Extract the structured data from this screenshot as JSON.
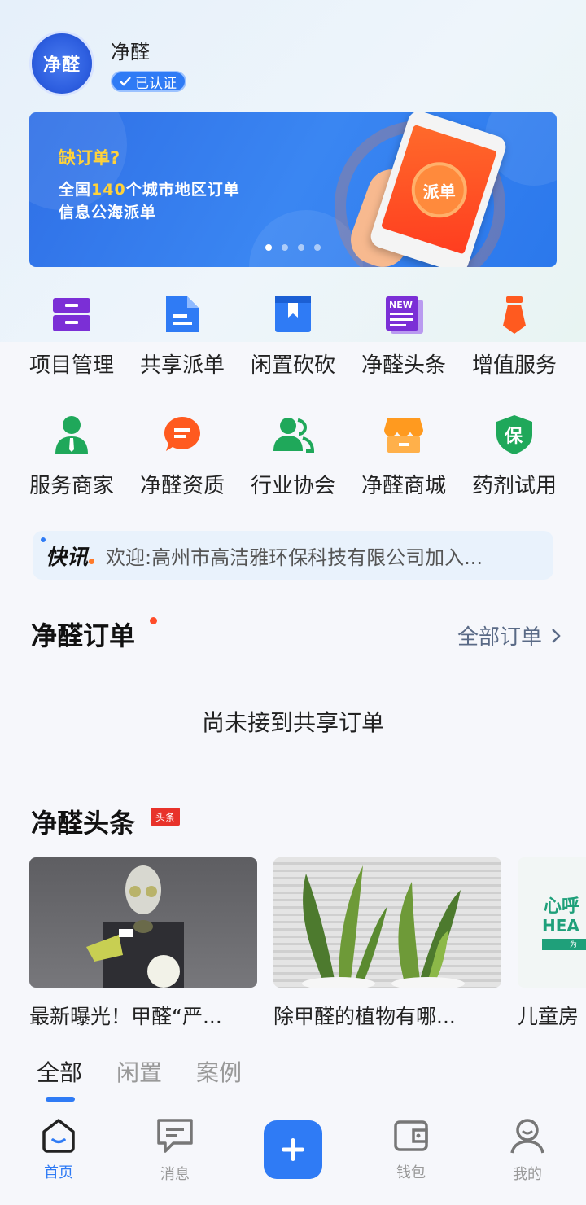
{
  "profile": {
    "logo_text": "净醛",
    "name": "净醛",
    "verified_label": "已认证"
  },
  "banner": {
    "title": "缺订单?",
    "line1_prefix": "全国",
    "line1_highlight": "140",
    "line1_suffix": "个城市地区订单",
    "line2": "信息公海派单",
    "phone_badge": "派单",
    "dots": 4,
    "active_dot": 0
  },
  "grid": {
    "items": [
      {
        "label": "项目管理",
        "icon": "cabinet-icon",
        "color": "#7b2fd6"
      },
      {
        "label": "共享派单",
        "icon": "document-icon",
        "color": "#2f7bf5"
      },
      {
        "label": "闲置砍砍",
        "icon": "box-icon",
        "color": "#2f7bf5"
      },
      {
        "label": "净醛头条",
        "icon": "news-icon",
        "color": "#7b2fd6",
        "badge": "NEW"
      },
      {
        "label": "增值服务",
        "icon": "tie-icon",
        "color": "#ff5a1f"
      },
      {
        "label": "服务商家",
        "icon": "person-icon",
        "color": "#1fa85a"
      },
      {
        "label": "净醛资质",
        "icon": "chat-icon",
        "color": "#ff5a1f"
      },
      {
        "label": "行业协会",
        "icon": "group-icon",
        "color": "#1fa85a"
      },
      {
        "label": "净醛商城",
        "icon": "store-icon",
        "color": "#ff9a1f"
      },
      {
        "label": "药剂试用",
        "icon": "shield-icon",
        "color": "#1fa85a",
        "badge": "保"
      }
    ]
  },
  "notice": {
    "tag": "快讯",
    "text": "欢迎:高州市高洁雅环保科技有限公司加入..."
  },
  "orders": {
    "title": "净醛订单",
    "all_link": "全部订单",
    "empty_text": "尚未接到共享订单"
  },
  "headlines": {
    "title": "净醛头条",
    "tag": "头条",
    "items": [
      {
        "caption": "最新曝光！甲醛“严..."
      },
      {
        "caption": "除甲醛的植物有哪..."
      },
      {
        "caption": "儿童房",
        "image_text_1": "心呼",
        "image_text_2": "HEA",
        "image_text_3": "为"
      }
    ]
  },
  "tabs": {
    "items": [
      "全部",
      "闲置",
      "案例"
    ],
    "active": 0
  },
  "bottom_nav": {
    "items": [
      {
        "label": "首页",
        "icon": "home-icon"
      },
      {
        "label": "消息",
        "icon": "message-icon"
      },
      {
        "label": "",
        "icon": "plus-icon"
      },
      {
        "label": "钱包",
        "icon": "wallet-icon"
      },
      {
        "label": "我的",
        "icon": "profile-icon"
      }
    ],
    "active": 0,
    "accent": "#2f7bf5"
  }
}
